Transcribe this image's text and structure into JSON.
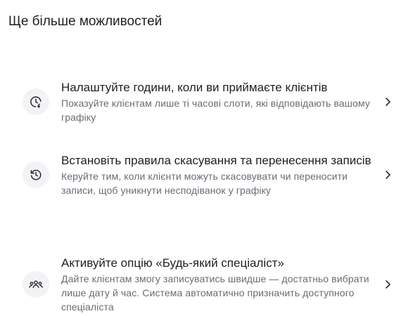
{
  "section": {
    "title": "Ще більше можливостей"
  },
  "items": [
    {
      "icon": "clock-hours-icon",
      "title": "Налаштуйте години, коли ви приймаєте клієнтів",
      "description": "Показуйте клієнтам лише ті часові слоти, які відповідають вашому графіку"
    },
    {
      "icon": "history-icon",
      "title": "Встановіть правила скасування та перенесення записів",
      "description": "Керуйте тим, коли клієнти можуть скасовувати чи переносити записи, щоб уникнути несподіванок у графіку"
    },
    {
      "icon": "group-users-icon",
      "title": "Активуйте опцію «Будь-який спеціаліст»",
      "description": "Дайте клієнтам змогу записуватись швидше — достатньо вибрати лише дату й час. Система автоматично призначить доступного спеціаліста"
    }
  ],
  "colors": {
    "title_text": "#1f1f1f",
    "description_text": "#6b6b74",
    "icon_background": "#f3f3f6",
    "icon_stroke": "#2b2b33"
  }
}
